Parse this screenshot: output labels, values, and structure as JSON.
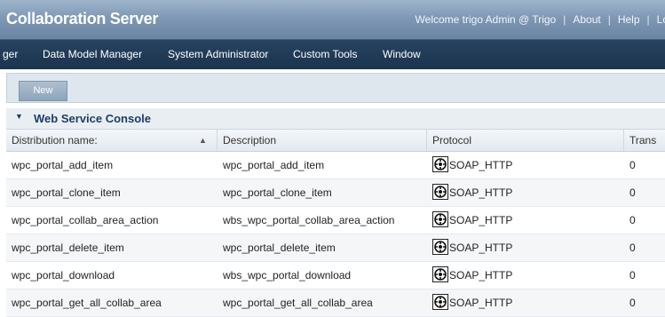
{
  "header": {
    "title": "Collaboration Server",
    "welcome": "Welcome trigo Admin @ Trigo",
    "links": [
      "About",
      "Help",
      "Lo"
    ]
  },
  "menu": [
    {
      "label": "ger"
    },
    {
      "label": "Data Model Manager"
    },
    {
      "label": "System Administrator"
    },
    {
      "label": "Custom Tools"
    },
    {
      "label": "Window"
    }
  ],
  "toolbar": {
    "new_label": "New"
  },
  "panel": {
    "title": "Web Service Console"
  },
  "table": {
    "columns": [
      "Distribution name:",
      "Description",
      "Protocol",
      "Trans"
    ],
    "rows": [
      {
        "name": "wpc_portal_add_item",
        "description": "wpc_portal_add_item",
        "protocol": "SOAP_HTTP",
        "trans": "0"
      },
      {
        "name": "wpc_portal_clone_item",
        "description": "wpc_portal_clone_item",
        "protocol": "SOAP_HTTP",
        "trans": "0"
      },
      {
        "name": "wpc_portal_collab_area_action",
        "description": "wbs_wpc_portal_collab_area_action",
        "protocol": "SOAP_HTTP",
        "trans": "0"
      },
      {
        "name": "wpc_portal_delete_item",
        "description": "wpc_portal_delete_item",
        "protocol": "SOAP_HTTP",
        "trans": "0"
      },
      {
        "name": "wpc_portal_download",
        "description": "wbs_wpc_portal_download",
        "protocol": "SOAP_HTTP",
        "trans": "0"
      },
      {
        "name": "wpc_portal_get_all_collab_area",
        "description": "wpc_portal_get_all_collab_area",
        "protocol": "SOAP_HTTP",
        "trans": "0"
      }
    ],
    "protocol_icon": "soap-protocol-icon"
  }
}
